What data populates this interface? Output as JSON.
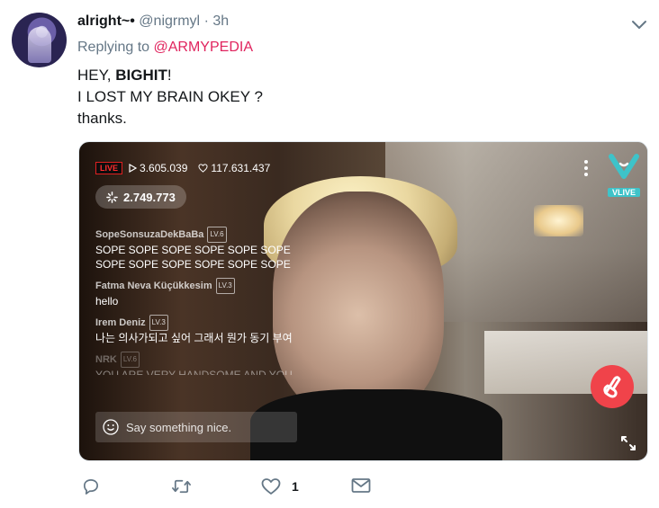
{
  "tweet": {
    "author_name": "alright~",
    "author_handle": "@nigrmyl",
    "time": "3h",
    "replying_to_label": "Replying to",
    "replying_to_handle": "@ARMYPEDIA",
    "line1_prefix": "HEY, ",
    "line1_bold": "BIGHIT",
    "line1_suffix": "!",
    "line2": "I LOST MY BRAIN OKEY ?",
    "line3": "thanks."
  },
  "vlive": {
    "live_label": "LIVE",
    "views": "3.605.039",
    "likes": "117.631.437",
    "hearts": "2.749.773",
    "logo_text": "VLIVE",
    "comment_placeholder": "Say something nice.",
    "chat": [
      {
        "user": "SopeSonsuzaDekBaBa",
        "level": "LV.6",
        "text": "SOPE SOPE SOPE SOPE SOPE SOPE SOPE SOPE SOPE SOPE SOPE SOPE"
      },
      {
        "user": "Fatma Neva Küçükkesim",
        "level": "LV.3",
        "text": "hello"
      },
      {
        "user": "Irem Deniz",
        "level": "LV.3",
        "text": "나는 의사가되고 싶어 그래서 뭔가 동기 부여"
      },
      {
        "user": "NRK",
        "level": "LV.6",
        "text": "YOU ARE VERY HANDSOME AND YOU"
      }
    ]
  },
  "actions": {
    "like_count": "1"
  },
  "colors": {
    "accent_pink": "#e0245e",
    "vlive_teal": "#3ec3c9",
    "heart_red": "#f0434a"
  }
}
